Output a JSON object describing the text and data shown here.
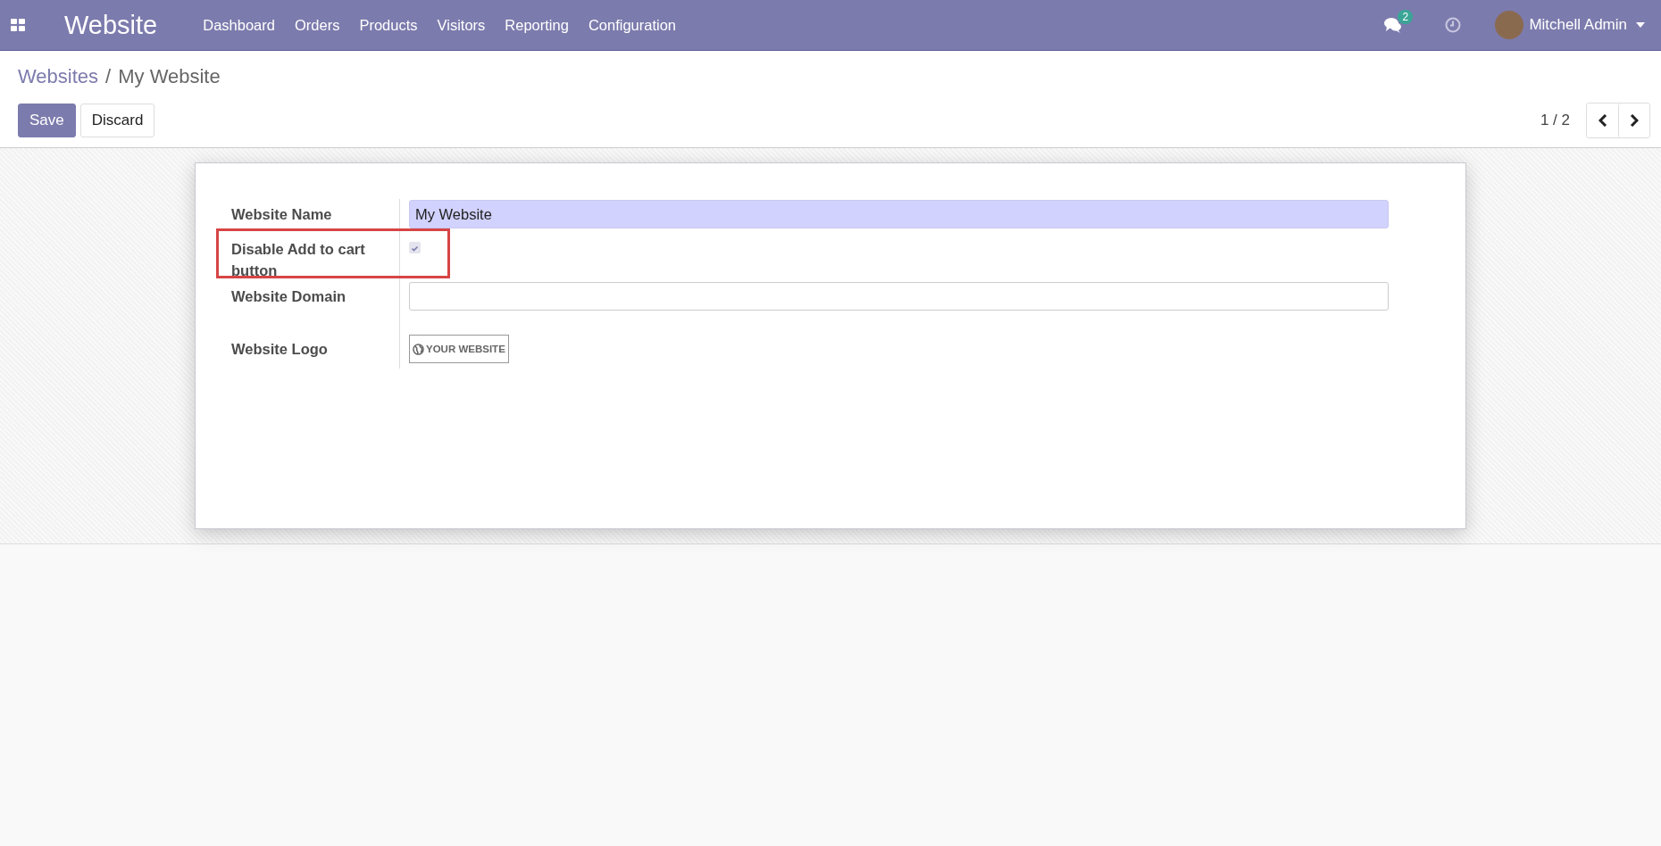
{
  "navbar": {
    "app_title": "Website",
    "menu": [
      {
        "label": "Dashboard"
      },
      {
        "label": "Orders"
      },
      {
        "label": "Products"
      },
      {
        "label": "Visitors"
      },
      {
        "label": "Reporting"
      },
      {
        "label": "Configuration"
      }
    ],
    "messages_badge": "2",
    "user_name": "Mitchell Admin"
  },
  "breadcrumb": [
    {
      "label": "Websites"
    },
    {
      "label": "My Website"
    }
  ],
  "breadcrumb_separator": "/",
  "buttons": [
    {
      "label": "Save",
      "kind": "primary"
    },
    {
      "label": "Discard",
      "kind": "secondary"
    }
  ],
  "pager": "1 / 2",
  "form": {
    "fields": [
      {
        "label": "Website Name",
        "kind": "text",
        "value": "My Website",
        "highlighted": false
      },
      {
        "label": "Disable Add to cart button",
        "kind": "checkbox",
        "checked": true,
        "highlighted": true
      },
      {
        "label": "Website Domain",
        "kind": "text",
        "highlighted": false
      },
      {
        "label": "Website Logo",
        "kind": "image",
        "logo_text": "YOUR WEBSITE",
        "highlighted": false
      }
    ]
  }
}
